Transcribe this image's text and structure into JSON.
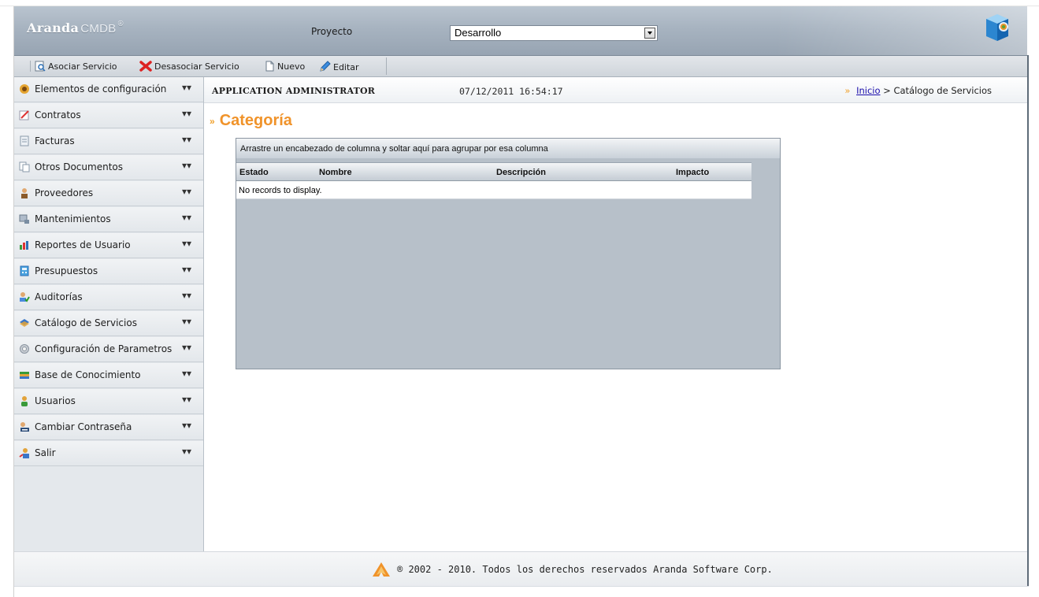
{
  "header": {
    "brand": "Aranda",
    "brand_sub": "CMDB",
    "brand_reg": "®",
    "project_label": "Proyecto",
    "project_selected": "Desarrollo"
  },
  "toolbar": {
    "associate": "Asociar Servicio",
    "dissociate": "Desasociar Servicio",
    "new": "Nuevo",
    "edit": "Editar"
  },
  "sidebar": {
    "items": [
      {
        "label": "Elementos de configuración",
        "icon": "config-items-icon"
      },
      {
        "label": "Contratos",
        "icon": "contracts-icon"
      },
      {
        "label": "Facturas",
        "icon": "invoices-icon"
      },
      {
        "label": "Otros Documentos",
        "icon": "documents-icon"
      },
      {
        "label": "Proveedores",
        "icon": "suppliers-icon"
      },
      {
        "label": "Mantenimientos",
        "icon": "maintenance-icon"
      },
      {
        "label": "Reportes de Usuario",
        "icon": "reports-icon"
      },
      {
        "label": "Presupuestos",
        "icon": "budget-icon"
      },
      {
        "label": "Auditorías",
        "icon": "audit-icon"
      },
      {
        "label": "Catálogo de Servicios",
        "icon": "service-catalog-icon"
      },
      {
        "label": "Configuración de Parametros",
        "icon": "settings-icon"
      },
      {
        "label": "Base de Conocimiento",
        "icon": "knowledge-base-icon"
      },
      {
        "label": "Usuarios",
        "icon": "users-icon"
      },
      {
        "label": "Cambiar Contraseña",
        "icon": "password-icon"
      },
      {
        "label": "Salir",
        "icon": "logout-icon"
      }
    ],
    "chevron": "»"
  },
  "info": {
    "user": "APPLICATION ADMINISTRATOR",
    "datetime": "07/12/2011 16:54:17",
    "breadcrumb_marker": "»",
    "breadcrumb_home": "Inicio",
    "breadcrumb_sep": ">",
    "breadcrumb_current": "Catálogo de Servicios"
  },
  "main": {
    "title_marker": "»",
    "title": "Categoría",
    "group_hint": "Arrastre un encabezado de columna y soltar aquí para agrupar por esa columna",
    "columns": [
      "Estado",
      "Nombre",
      "Descripción",
      "Impacto"
    ],
    "empty_text": "No records to display."
  },
  "footer": {
    "copyright": "® 2002 - 2010. Todos los derechos reservados Aranda Software Corp."
  },
  "colors": {
    "accent": "#f0932a",
    "header": "#a7b3c0"
  }
}
